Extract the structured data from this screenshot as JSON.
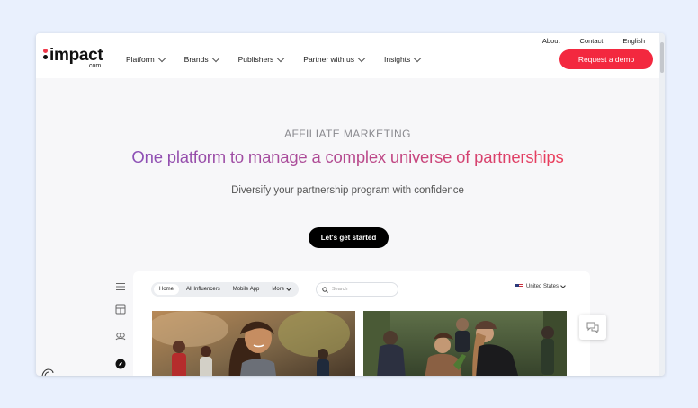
{
  "top_links": {
    "about": "About",
    "contact": "Contact",
    "language": "English"
  },
  "logo": {
    "word": "impact",
    "suffix": ".com"
  },
  "nav": [
    {
      "label": "Platform"
    },
    {
      "label": "Brands"
    },
    {
      "label": "Publishers"
    },
    {
      "label": "Partner with us"
    },
    {
      "label": "Insights"
    }
  ],
  "demo_button": "Request a demo",
  "hero": {
    "eyebrow": "AFFILIATE MARKETING",
    "headline": "One platform to manage a complex universe of partnerships",
    "subhead": "Diversify your partnership program with confidence",
    "cta": "Let's get started"
  },
  "app_preview": {
    "tabs": [
      {
        "label": "Home"
      },
      {
        "label": "All Influencers"
      },
      {
        "label": "Mobile App"
      },
      {
        "label": "More"
      }
    ],
    "search_placeholder": "Search",
    "country": "United States"
  },
  "colors": {
    "accent": "#f3283f",
    "background": "#e9f0fd",
    "headline_gradient_start": "#8b4fb6",
    "headline_gradient_end": "#ec3d5a"
  }
}
